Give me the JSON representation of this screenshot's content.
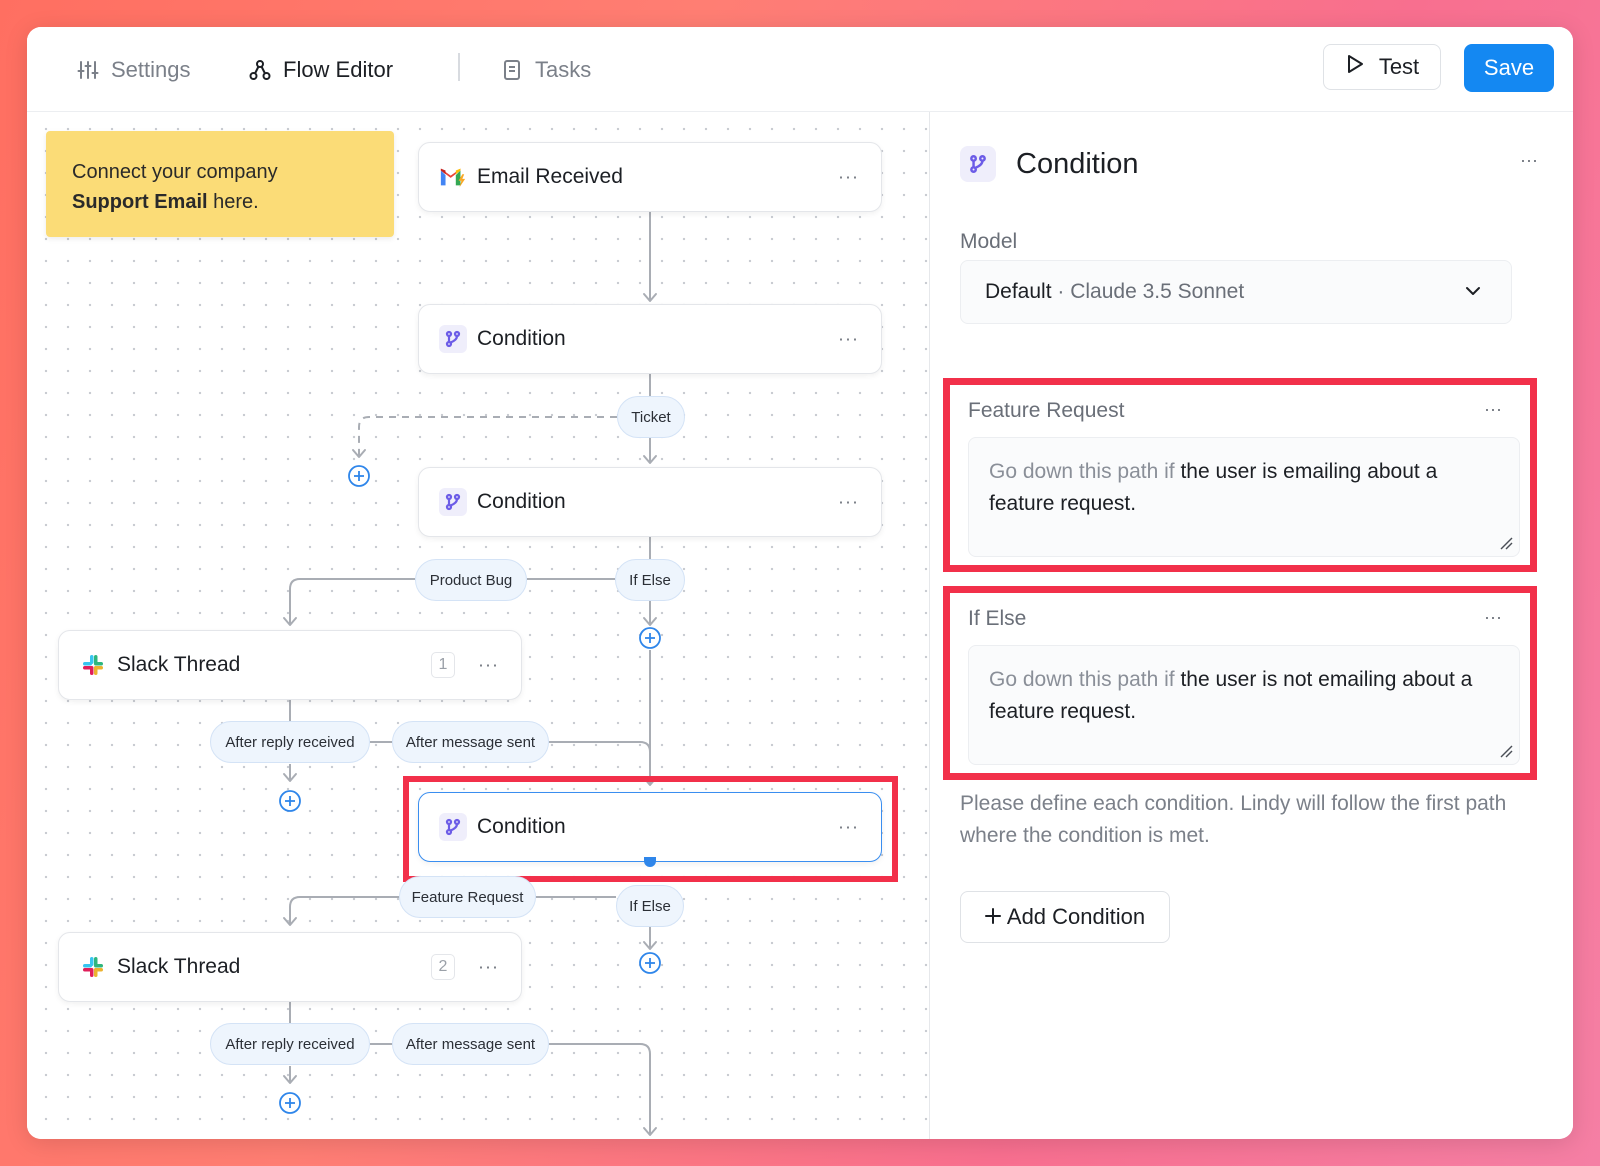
{
  "nav": {
    "settings": "Settings",
    "flow_editor": "Flow Editor",
    "tasks": "Tasks",
    "test": "Test",
    "save": "Save"
  },
  "canvas": {
    "note_line1": "Connect your company",
    "note_bold": "Support Email",
    "note_tail": " here.",
    "nodes": {
      "email": "Email Received",
      "cond1": "Condition",
      "cond2": "Condition",
      "slack1": "Slack Thread",
      "slack1_badge": "1",
      "cond3": "Condition",
      "slack2": "Slack Thread",
      "slack2_badge": "2",
      "dots": "···"
    },
    "pills": {
      "ticket": "Ticket",
      "product_bug": "Product Bug",
      "if_else_1": "If Else",
      "after_reply_1": "After reply received",
      "after_sent_1": "After message sent",
      "feature_request": "Feature Request",
      "if_else_2": "If Else",
      "after_reply_2": "After reply received",
      "after_sent_2": "After message sent"
    }
  },
  "panel": {
    "title": "Condition",
    "dots": "···",
    "model_label": "Model",
    "model_default": "Default",
    "model_sep": " · ",
    "model_name": "Claude 3.5 Sonnet",
    "conditions": [
      {
        "title": "Feature Request",
        "prefix": "Go down this path if",
        "text": " the user is emailing about a feature request."
      },
      {
        "title": "If Else",
        "prefix": "Go down this path if",
        "text": " the user is not emailing about a feature request."
      }
    ],
    "help": "Please define each condition. Lindy will follow the first path where the condition is met.",
    "add_condition": "Add Condition"
  },
  "colors": {
    "accent": "#1488f2",
    "highlight": "#f2304a",
    "note": "#fbdc77",
    "condition_icon": "#6c5ce7"
  }
}
